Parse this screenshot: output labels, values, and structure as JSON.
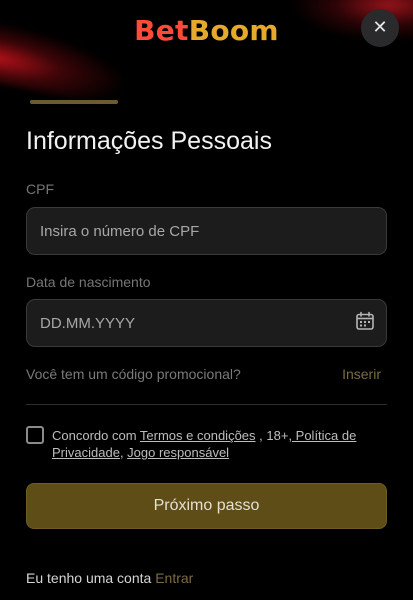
{
  "brand": {
    "logo_part1": "Bet",
    "logo_part2": "Boom",
    "color_part1": "#ff4a3a",
    "color_part2": "#e5a92b"
  },
  "header": {
    "close_icon": "close-icon",
    "close_glyph": "✕"
  },
  "progress": {
    "step_fraction": 0.25
  },
  "form": {
    "title": "Informações Pessoais",
    "cpf": {
      "label": "CPF",
      "placeholder": "Insira o número de CPF",
      "value": ""
    },
    "birthdate": {
      "label": "Data de nascimento",
      "placeholder": "DD.MM.YYYY",
      "value": "",
      "icon": "calendar-icon"
    },
    "promo": {
      "question": "Você tem um código promocional?",
      "link": "Inserir"
    },
    "consent": {
      "checked": false,
      "prefix": "Concordo com ",
      "terms_link": "Termos e condições",
      "middle": " , 18+",
      "privacy_link": ", Política de Privacidade",
      "separator": ", ",
      "responsible_link": "Jogo responsável"
    },
    "next_button": "Próximo passo"
  },
  "footer": {
    "have_account": "Eu tenho uma conta",
    "login_link": "Entrar"
  },
  "colors": {
    "background": "#000000",
    "accent_gold": "#5e4d17",
    "link_gold": "#7c6a44"
  }
}
